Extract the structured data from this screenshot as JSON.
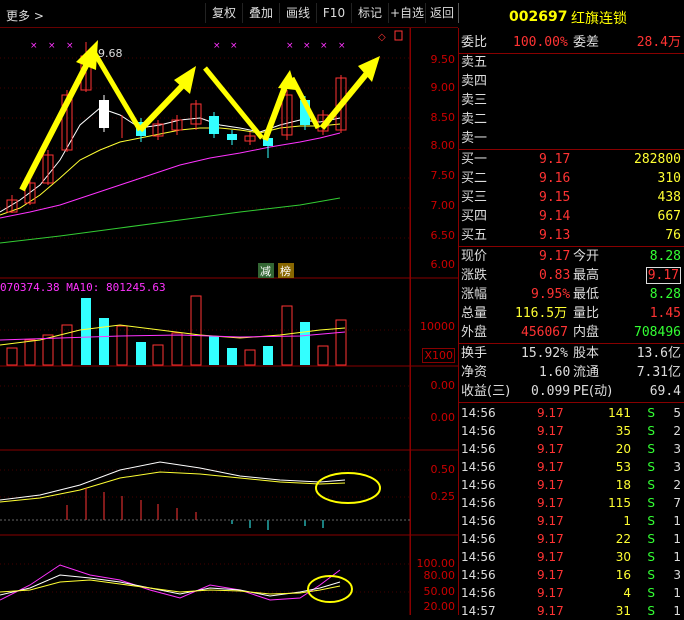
{
  "toolbar": {
    "more": "更多 >",
    "buttons": [
      "复权",
      "叠加",
      "画线",
      "F10",
      "标记",
      "+自选",
      "返回"
    ]
  },
  "stock": {
    "code": "002697",
    "name": "红旗连锁"
  },
  "chart": {
    "price_ticks": [
      "9.50",
      "9.00",
      "8.50",
      "8.00",
      "7.50",
      "7.00",
      "6.50",
      "6.00"
    ],
    "max_label": "9.68",
    "badges": [
      "减",
      "榜"
    ],
    "volume_legend": "070374.38  MA10: 801245.63",
    "volume_tick": "10000",
    "volume_unit": "X100",
    "panel3_ticks": [
      "0.00",
      "0.00"
    ],
    "macd_ticks": [
      "0.50",
      "0.25"
    ],
    "kdj_ticks": [
      "100.00",
      "80.00",
      "50.00",
      "20.00"
    ]
  },
  "orderbook": {
    "weibi_label": "委比",
    "weibi_value": "100.00%",
    "weicha_label": "委差",
    "weicha_value": "28.4万",
    "sell": [
      "卖五",
      "卖四",
      "卖三",
      "卖二",
      "卖一"
    ],
    "buy": [
      {
        "label": "买一",
        "price": "9.17",
        "vol": "282800"
      },
      {
        "label": "买二",
        "price": "9.16",
        "vol": "310"
      },
      {
        "label": "买三",
        "price": "9.15",
        "vol": "438"
      },
      {
        "label": "买四",
        "price": "9.14",
        "vol": "667"
      },
      {
        "label": "买五",
        "price": "9.13",
        "vol": "76"
      }
    ]
  },
  "quote": {
    "xianjia_l": "现价",
    "xianjia": "9.17",
    "jinkai_l": "今开",
    "jinkai": "8.28",
    "zhangdie_l": "涨跌",
    "zhangdie": "0.83",
    "zuigao_l": "最高",
    "zuigao": "9.17",
    "zhangfu_l": "涨幅",
    "zhangfu": "9.95%",
    "zuidi_l": "最低",
    "zuidi": "8.28",
    "zongliang_l": "总量",
    "zongliang": "116.5万",
    "liangbi_l": "量比",
    "liangbi": "1.45",
    "waipan_l": "外盘",
    "waipan": "456067",
    "neipan_l": "内盘",
    "neipan": "708496",
    "huanshou_l": "换手",
    "huanshou": "15.92%",
    "guben_l": "股本",
    "guben": "13.6亿",
    "jingzi_l": "净资",
    "jingzi": "1.60",
    "liutong_l": "流通",
    "liutong": "7.31亿",
    "shouyi_l": "收益(三)",
    "shouyi": "0.099",
    "pe_l": "PE(动)",
    "pe": "69.4"
  },
  "ticks": [
    {
      "t": "14:56",
      "p": "9.17",
      "v": "141",
      "s": "S",
      "n": "5"
    },
    {
      "t": "14:56",
      "p": "9.17",
      "v": "35",
      "s": "S",
      "n": "2"
    },
    {
      "t": "14:56",
      "p": "9.17",
      "v": "20",
      "s": "S",
      "n": "3"
    },
    {
      "t": "14:56",
      "p": "9.17",
      "v": "53",
      "s": "S",
      "n": "3"
    },
    {
      "t": "14:56",
      "p": "9.17",
      "v": "18",
      "s": "S",
      "n": "2"
    },
    {
      "t": "14:56",
      "p": "9.17",
      "v": "115",
      "s": "S",
      "n": "7"
    },
    {
      "t": "14:56",
      "p": "9.17",
      "v": "1",
      "s": "S",
      "n": "1"
    },
    {
      "t": "14:56",
      "p": "9.17",
      "v": "22",
      "s": "S",
      "n": "1"
    },
    {
      "t": "14:56",
      "p": "9.17",
      "v": "30",
      "s": "S",
      "n": "1"
    },
    {
      "t": "14:56",
      "p": "9.17",
      "v": "16",
      "s": "S",
      "n": "3"
    },
    {
      "t": "14:56",
      "p": "9.17",
      "v": "4",
      "s": "S",
      "n": "1"
    },
    {
      "t": "14:57",
      "p": "9.17",
      "v": "31",
      "s": "S",
      "n": "1"
    }
  ]
}
